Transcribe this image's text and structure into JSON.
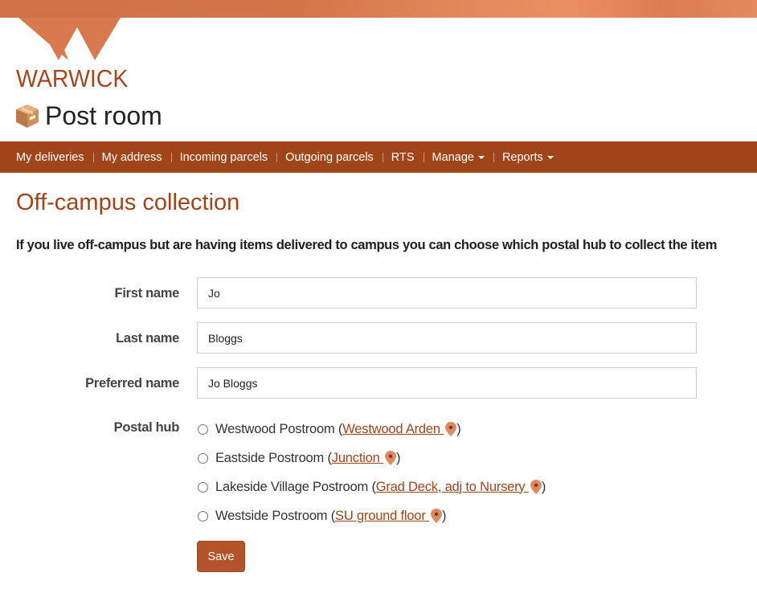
{
  "brand": {
    "logo_text": "WARWICK",
    "accent_color": "#a0451a",
    "logo_color": "#d97a4e"
  },
  "app": {
    "title": "Post room",
    "icon": "parcel-box-icon"
  },
  "nav": {
    "items": [
      {
        "label": "My deliveries",
        "dropdown": false
      },
      {
        "label": "My address",
        "dropdown": false
      },
      {
        "label": "Incoming parcels",
        "dropdown": false
      },
      {
        "label": "Outgoing parcels",
        "dropdown": false
      },
      {
        "label": "RTS",
        "dropdown": false
      },
      {
        "label": "Manage",
        "dropdown": true
      },
      {
        "label": "Reports",
        "dropdown": true
      }
    ]
  },
  "page": {
    "heading": "Off-campus collection",
    "intro": "If you live off-campus but are having items delivered to campus you can choose which postal hub to collect the item"
  },
  "form": {
    "first_name": {
      "label": "First name",
      "value": "Jo"
    },
    "last_name": {
      "label": "Last name",
      "value": "Bloggs"
    },
    "preferred_name": {
      "label": "Preferred name",
      "value": "Jo Bloggs"
    },
    "postal_hub": {
      "label": "Postal hub",
      "options": [
        {
          "name": "Westwood Postroom",
          "location": "Westwood Arden",
          "selected": false
        },
        {
          "name": "Eastside Postroom",
          "location": "Junction",
          "selected": false
        },
        {
          "name": "Lakeside Village Postroom",
          "location": "Grad Deck, adj to Nursery",
          "selected": false
        },
        {
          "name": "Westside Postroom",
          "location": "SU ground floor",
          "selected": false
        }
      ]
    },
    "save_label": "Save"
  }
}
